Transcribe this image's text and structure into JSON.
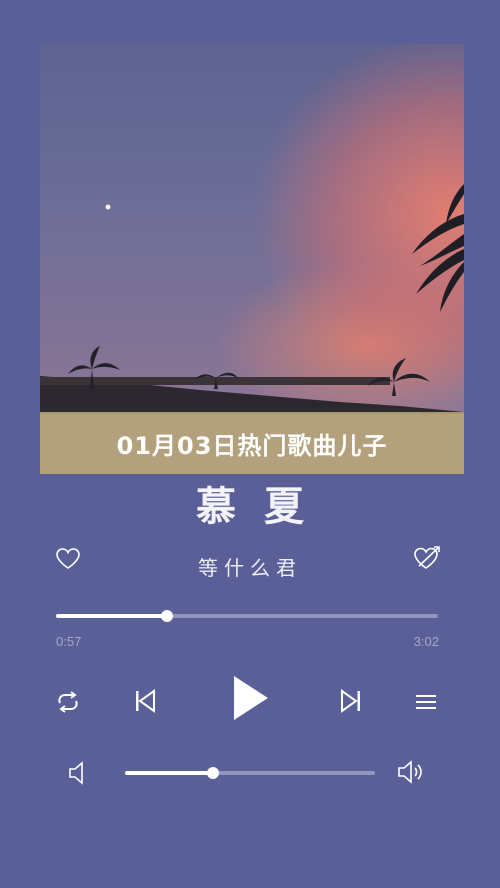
{
  "banner": {
    "title": "01月03日热门歌曲儿子"
  },
  "song": {
    "title": "慕夏",
    "artist": "等什么君"
  },
  "playback": {
    "elapsed": "0:57",
    "duration": "3:02",
    "progress_fraction": 0.29,
    "volume_fraction": 0.35,
    "state": "paused"
  },
  "icons": {
    "like": "heart-outline-icon",
    "favorite": "heart-arrow-icon",
    "loop": "repeat-icon",
    "previous": "skip-previous-icon",
    "play": "play-icon",
    "next": "skip-next-icon",
    "playlist": "menu-icon",
    "volume_down": "volume-low-icon",
    "volume_up": "volume-high-icon"
  },
  "colors": {
    "background": "#5a5f98",
    "banner": "#c6b076",
    "accent": "#ffffff"
  }
}
